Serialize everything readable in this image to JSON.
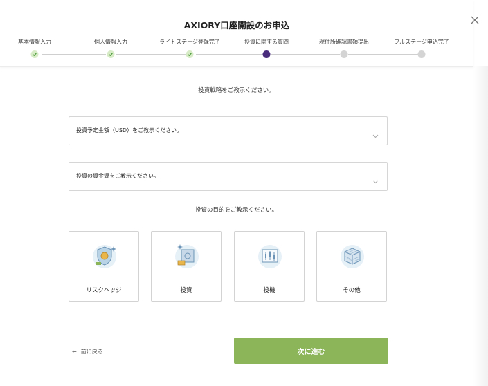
{
  "header": {
    "title": "AXIORY口座開設のお申込"
  },
  "steps": [
    {
      "label": "基本情報入力",
      "status": "done"
    },
    {
      "label": "個人情報入力",
      "status": "done"
    },
    {
      "label": "ライトステージ登録完了",
      "status": "done"
    },
    {
      "label": "投資に関する質問",
      "status": "current"
    },
    {
      "label": "現住所確認書類提出",
      "status": "todo"
    },
    {
      "label": "フルステージ申込完了",
      "status": "todo"
    }
  ],
  "form": {
    "strategy_heading": "投資戦略をご教示ください。",
    "amount_select": "投資予定金額（USD）をご教示ください。",
    "source_select": "投資の資金源をご教示ください。",
    "purpose_heading": "投資の目的をご教示ください。",
    "purposes": [
      {
        "label": "リスクヘッジ",
        "icon": "shield-coin-icon"
      },
      {
        "label": "投資",
        "icon": "safe-money-icon"
      },
      {
        "label": "投機",
        "icon": "trading-chart-icon"
      },
      {
        "label": "その他",
        "icon": "cube-icon"
      }
    ]
  },
  "footer": {
    "back_label": "前に戻る",
    "next_label": "次に進む"
  },
  "colors": {
    "accent": "#8cb55a",
    "current_step": "#4a2c7c",
    "done_step": "#d7ebc6",
    "todo_step": "#d4d4d4"
  }
}
